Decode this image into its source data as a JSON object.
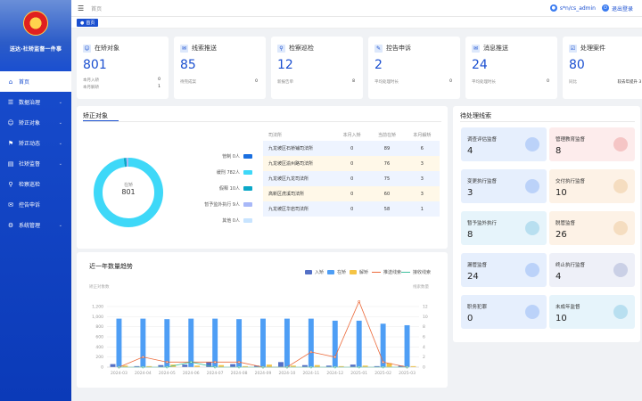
{
  "sidebar": {
    "title": "送达·社矫监督一件事",
    "items": [
      {
        "label": "首页",
        "icon": "home-icon",
        "active": true,
        "chevron": false
      },
      {
        "label": "数据治理",
        "icon": "database-icon",
        "chevron": true
      },
      {
        "label": "矫正对象",
        "icon": "user-icon",
        "chevron": true
      },
      {
        "label": "矫正动态",
        "icon": "activity-icon",
        "chevron": true
      },
      {
        "label": "社矫监督",
        "icon": "monitor-icon",
        "chevron": true
      },
      {
        "label": "检察巡检",
        "icon": "search-icon",
        "chevron": false
      },
      {
        "label": "控告申诉",
        "icon": "message-icon",
        "chevron": false
      },
      {
        "label": "系统管理",
        "icon": "gear-icon",
        "chevron": true
      }
    ]
  },
  "topbar": {
    "breadcrumb": "首页",
    "user": "s*n/cs_admin",
    "logout": "退出登录"
  },
  "tags": {
    "home": "首页"
  },
  "cards": [
    {
      "title": "在矫对象",
      "value": "801",
      "rows": [
        [
          "本月入矫",
          "0"
        ],
        [
          "本月解矫",
          "1"
        ]
      ]
    },
    {
      "title": "线索推送",
      "value": "85",
      "rows": [
        [
          "待完成案",
          "0"
        ]
      ]
    },
    {
      "title": "检察巡检",
      "value": "12",
      "rows": [
        [
          "新报告单",
          "8"
        ]
      ]
    },
    {
      "title": "控告申诉",
      "value": "2",
      "rows": [
        [
          "平均处理时长",
          "0"
        ]
      ]
    },
    {
      "title": "消息推送",
      "value": "24",
      "rows": [
        [
          "平均处理时长",
          "0"
        ]
      ]
    },
    {
      "title": "处理案件",
      "value": "80",
      "rows": [
        [
          "同比",
          "较去年提升 3 %"
        ]
      ]
    }
  ],
  "corrections": {
    "title": "矫正对象",
    "donut": {
      "center_label": "在矫",
      "center_value": "801"
    },
    "legend": [
      {
        "label": "管制 0人",
        "value": 0,
        "color": "#1a6fe0"
      },
      {
        "label": "缓刑 782人",
        "value": 782,
        "color": "#3ed8f8"
      },
      {
        "label": "假释 10人",
        "value": 10,
        "color": "#0aa8c8"
      },
      {
        "label": "暂予监外执行 9人",
        "value": 9,
        "color": "#a8b8f8"
      },
      {
        "label": "其他 0人",
        "value": 0,
        "color": "#c8e4ff"
      }
    ],
    "table": {
      "headers": [
        "司法所",
        "本月入矫",
        "当前在矫",
        "本月解矫"
      ],
      "rows": [
        [
          "九龙坡区石桥铺司法所",
          "0",
          "89",
          "6"
        ],
        [
          "九龙坡区渝州路司法所",
          "0",
          "76",
          "3"
        ],
        [
          "九龙坡区九龙司法所",
          "0",
          "75",
          "3"
        ],
        [
          "高新区虎溪司法所",
          "0",
          "60",
          "3"
        ],
        [
          "九龙坡区华岩司法所",
          "0",
          "58",
          "1"
        ]
      ]
    }
  },
  "chart_data": {
    "type": "bar",
    "title": "近一年数量趋势",
    "y_left_label": "矫正对象数",
    "y_right_label": "线索数量",
    "categories": [
      "2024-03",
      "2024-04",
      "2024-05",
      "2024-06",
      "2024-07",
      "2024-08",
      "2024-09",
      "2024-10",
      "2024-11",
      "2024-12",
      "2025-01",
      "2025-02",
      "2025-03"
    ],
    "y_left_ticks": [
      "1,200",
      "1,000",
      "800",
      "600",
      "400",
      "200",
      "0"
    ],
    "y_right_ticks": [
      "12",
      "10",
      "8",
      "6",
      "4",
      "2",
      "0"
    ],
    "ylim_left": [
      0,
      1200
    ],
    "ylim_right": [
      0,
      12
    ],
    "series": [
      {
        "name": "入矫",
        "type": "bar",
        "axis": "left",
        "color": "#5470c6",
        "values": [
          60,
          20,
          40,
          50,
          100,
          60,
          30,
          100,
          40,
          30,
          50,
          20,
          30
        ]
      },
      {
        "name": "在矫",
        "type": "bar",
        "axis": "left",
        "color": "#4e9ef5",
        "values": [
          960,
          960,
          950,
          960,
          960,
          950,
          960,
          960,
          960,
          920,
          920,
          860,
          830
        ]
      },
      {
        "name": "解矫",
        "type": "bar",
        "axis": "left",
        "color": "#f5c445",
        "values": [
          30,
          20,
          50,
          30,
          40,
          20,
          50,
          30,
          40,
          20,
          30,
          80,
          20
        ]
      },
      {
        "name": "推送线索",
        "type": "line",
        "axis": "right",
        "color": "#ec6a3a",
        "values": [
          0,
          2,
          1,
          1,
          1,
          1,
          0,
          0,
          3,
          2,
          13,
          1,
          0
        ]
      },
      {
        "name": "接收线索",
        "type": "line",
        "axis": "right",
        "color": "#3bbf9d",
        "values": [
          0,
          0,
          0,
          1,
          0,
          0,
          0,
          0,
          0,
          0,
          0,
          0,
          0
        ]
      }
    ]
  },
  "pending": {
    "title": "待处理线索",
    "items": [
      {
        "label": "调查评估监督",
        "value": "4",
        "bg": "#e6effd",
        "deco": "#3a7bf0"
      },
      {
        "label": "管理教育监督",
        "value": "8",
        "bg": "#fdecec",
        "deco": "#e05050"
      },
      {
        "label": "变更执行监督",
        "value": "3",
        "bg": "#e6effd",
        "deco": "#3a7bf0"
      },
      {
        "label": "交付执行监督",
        "value": "10",
        "bg": "#fdf2e6",
        "deco": "#e0a050"
      },
      {
        "label": "暂予监外执行",
        "value": "8",
        "bg": "#e6f4fb",
        "deco": "#30a0d0"
      },
      {
        "label": "脱管监督",
        "value": "26",
        "bg": "#fdf2e6",
        "deco": "#e0a050"
      },
      {
        "label": "漏管监督",
        "value": "24",
        "bg": "#e6effd",
        "deco": "#3a7bf0"
      },
      {
        "label": "终止执行监督",
        "value": "4",
        "bg": "#eef0f8",
        "deco": "#6070b0"
      },
      {
        "label": "职务犯罪",
        "value": "0",
        "bg": "#e6effd",
        "deco": "#3a7bf0"
      },
      {
        "label": "未成年监督",
        "value": "10",
        "bg": "#e6f4fb",
        "deco": "#30a0d0"
      }
    ]
  }
}
